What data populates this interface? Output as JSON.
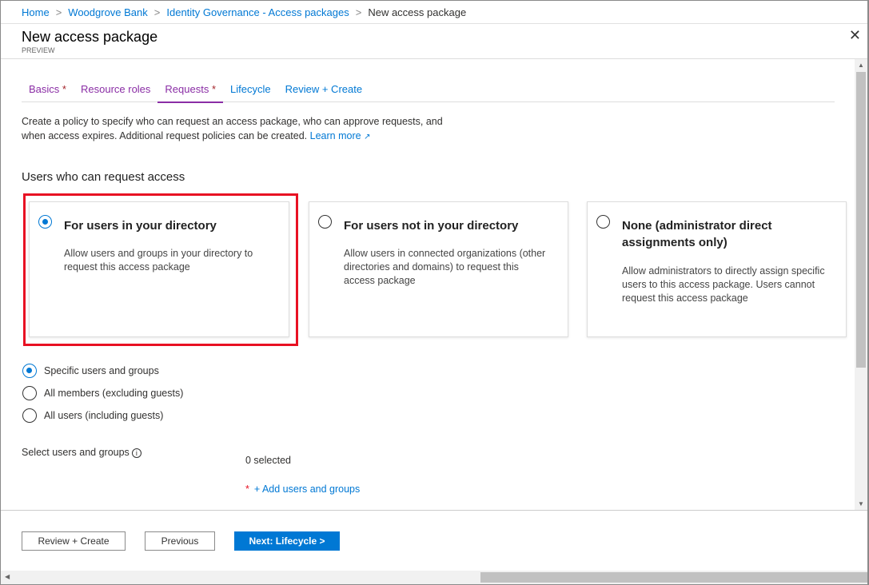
{
  "breadcrumb": [
    "Home",
    "Woodgrove Bank",
    "Identity Governance - Access packages",
    "New access package"
  ],
  "header": {
    "title": "New access package",
    "subtitle": "PREVIEW"
  },
  "tabs": [
    {
      "label": "Basics",
      "required": "*"
    },
    {
      "label": "Resource roles"
    },
    {
      "label": "Requests",
      "required": "*"
    },
    {
      "label": "Lifecycle"
    },
    {
      "label": "Review + Create"
    }
  ],
  "description": "Create a policy to specify who can request an access package, who can approve requests, and when access expires. Additional request policies can be created. ",
  "learn_more": "Learn more",
  "section_title": "Users who can request access",
  "cards": [
    {
      "title": "For users in your directory",
      "text": "Allow users and groups in your directory to request this access package",
      "selected": true
    },
    {
      "title": "For users not in your directory",
      "text": "Allow users in connected organizations (other directories and domains) to request this access package",
      "selected": false
    },
    {
      "title": "None (administrator direct assignments only)",
      "text": "Allow administrators to directly assign specific users to this access package. Users cannot request this access package",
      "selected": false
    }
  ],
  "scope_options": [
    {
      "label": "Specific users and groups",
      "selected": true
    },
    {
      "label": "All members (excluding guests)"
    },
    {
      "label": "All users (including guests)"
    }
  ],
  "select_label": "Select users and groups",
  "selected_count": "0 selected",
  "add_required": "*",
  "add_link": "+ Add users and groups",
  "footer": {
    "review": "Review + Create",
    "previous": "Previous",
    "next": "Next: Lifecycle >"
  }
}
